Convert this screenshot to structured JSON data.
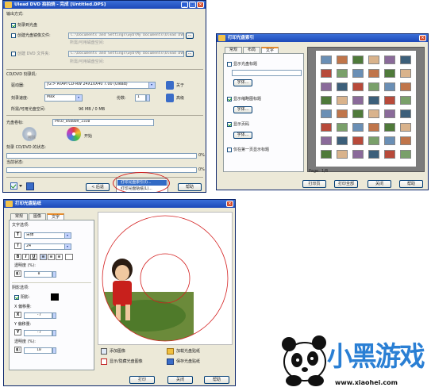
{
  "main_window": {
    "title": "Ulead DVD 拍拍烧 - 完成 [Untitled.DPS]",
    "output_label": "输出方式:",
    "burn_disc_label": "刻录到光盘",
    "create_image_label": "创建光盘镜像文件:",
    "create_folder_label": "创建 DVD 文件夹:",
    "path1": "C:\\Documents and Settings\\wyb\\My Documents\\Ulead DVD D",
    "path1_note": "所需/可用磁盘空间:",
    "path2": "C:\\Documents and Settings\\wyb\\My Documents\\Ulead DVD D",
    "path2_note": "所需/可用磁盘空间:",
    "recorder_group": "CD/DVD 刻录机:",
    "drive_label": "驱动器:",
    "drive_value": "[G:> ATAPI CD-RW 24X10X40  7.00 (Ulead)",
    "about_button": "关于",
    "speed_label": "刻录速度:",
    "speed_value": "Max",
    "copies_label": "份数:",
    "copies_value": "1",
    "advanced_button": "高级",
    "space_label": "所需/可用光盘空间:",
    "space_value": "96 MB / 0 MB",
    "volume_label": "光盘卷标:",
    "volume_value": "PVCD_050809_2330",
    "erase_label": "擦除",
    "start_label": "开始",
    "recorder_status_label": "刻录 CD/DVD 的状态:",
    "progress1_pct": "0%",
    "current_status_label": "当前状态:",
    "progress2_pct": "0%",
    "back_button": "< 后退",
    "print_index_menu": "打印光盘索引(I)...",
    "print_label_menu": "打印光盘贴纸(L)...",
    "help_button": "帮助"
  },
  "index_window": {
    "title": "打印光盘索引",
    "tabs": [
      "常规",
      "布局",
      "文字"
    ],
    "show_title_label": "显示光盘标题",
    "font_button_1": "字体...",
    "show_thumb_label": "显示缩略图标题",
    "font_button_2": "字体...",
    "show_page_label": "显示页码",
    "font_button_3": "字体...",
    "first_page_label": "仅在第一页显示标题",
    "page_label": "Page:",
    "page_value": "1/8",
    "print_page_button": "打印页",
    "print_all_button": "打印全部",
    "close_button": "关闭",
    "help_button": "帮助"
  },
  "label_window": {
    "title": "打印光盘贴纸",
    "tabs": [
      "常规",
      "图像",
      "文字"
    ],
    "text_options_label": "文字选项:",
    "font_value": "宋体",
    "size_value": "24",
    "bold": "B",
    "italic": "I",
    "underline": "U",
    "transparency_label": "透明度 (%):",
    "transparency_value": "0",
    "shadow_options_label": "阴影选项:",
    "shadow_label": "阴影:",
    "x_offset_label": "X 偏移量:",
    "x_offset_value": "-7",
    "y_offset_label": "Y 偏移量:",
    "y_offset_value": "-7",
    "shadow_transparency_label": "透明度 (%):",
    "shadow_transparency_value": "10",
    "add_image_button": "添加图像",
    "load_label_button": "加载光盘贴纸",
    "show_hide_button": "显示/隐藏光盘图像",
    "save_label_button": "保存光盘贴纸",
    "print_button": "打印",
    "close_button": "关闭",
    "help_button": "帮助"
  },
  "watermark": {
    "logo_text": "小黑游戏",
    "url": "www.xiaohei.com"
  },
  "colors": {
    "window_bg": "#ece9d8",
    "title_bar": "#2456c8",
    "highlight_ellipse": "#d42020",
    "logo_blue": "#2a7fd4"
  }
}
